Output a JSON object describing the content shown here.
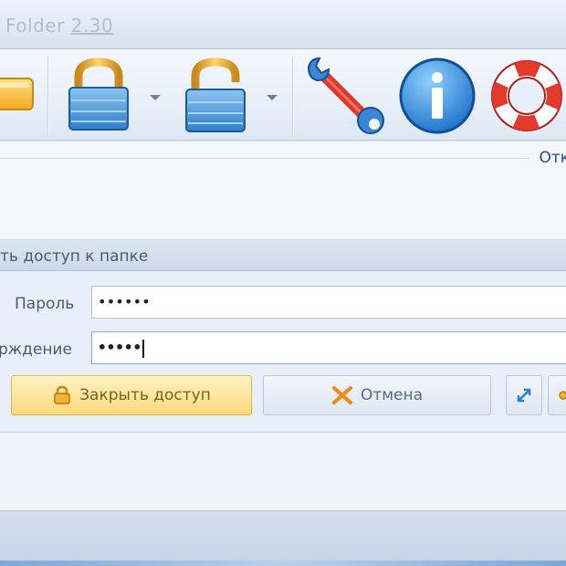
{
  "window": {
    "title": "Folder",
    "version": "2.30"
  },
  "toolbar": {
    "buttons": [
      {
        "name": "folder-button",
        "icon": "folder-icon"
      },
      {
        "name": "lock-button",
        "icon": "lock-closed-icon"
      },
      {
        "name": "unlock-button",
        "icon": "lock-open-icon"
      },
      {
        "name": "settings-button",
        "icon": "wrench-icon"
      },
      {
        "name": "info-button",
        "icon": "info-icon"
      },
      {
        "name": "help-button",
        "icon": "lifebuoy-icon"
      }
    ]
  },
  "ribbon": {
    "link_label": "Отк"
  },
  "panel": {
    "header": "ть доступ к папке",
    "password_label": "Пароль",
    "password_value": "••••••",
    "confirm_label": "рждение",
    "confirm_value": "•••••",
    "close_access_label": "Закрыть доступ",
    "cancel_label": "Отмена"
  },
  "colors": {
    "accent_yellow": "#ffd97a",
    "lock_blue": "#3d8fd6",
    "wrench_red": "#e0362c",
    "info_blue": "#1e7fd6",
    "link_blue": "#2c4a86"
  }
}
